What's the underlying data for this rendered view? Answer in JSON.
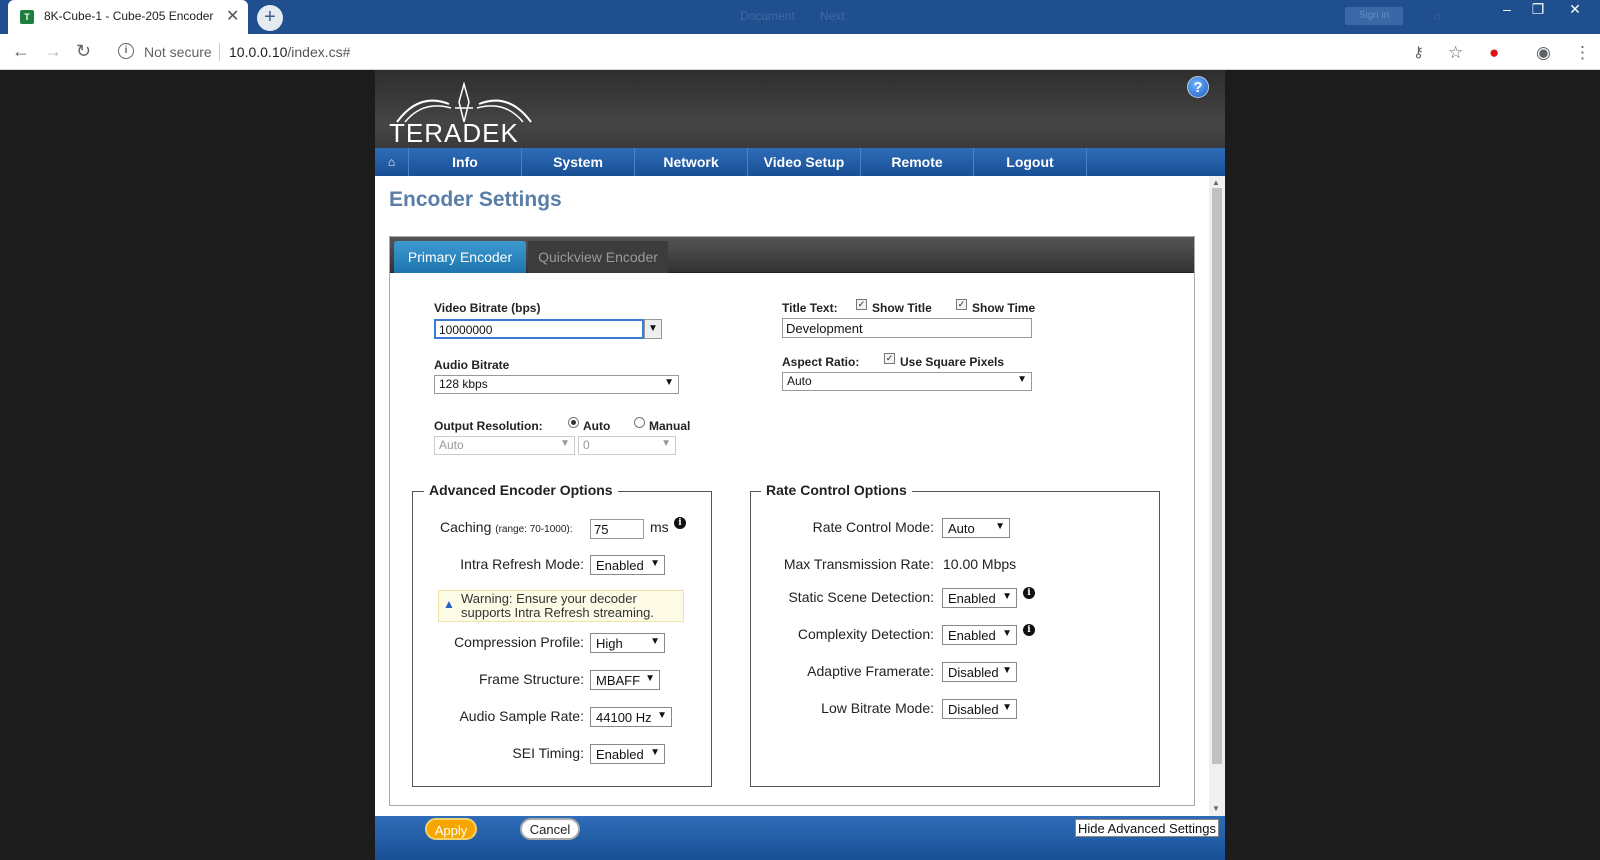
{
  "browser": {
    "tab_title": "8K-Cube-1 - Cube-205 Encoder",
    "faded_title_1": "Document",
    "faded_title_2": "Next",
    "faded_button": "Sign in",
    "not_secure": "Not secure",
    "url_host": "10.0.0.10",
    "url_path": "/index.cs#"
  },
  "brand": {
    "logo_text": "TERADEK"
  },
  "nav": [
    "Info",
    "System",
    "Network",
    "Video Setup",
    "Remote",
    "Logout"
  ],
  "page_title": "Encoder Settings",
  "tabs": {
    "primary": "Primary Encoder",
    "quickview": "Quickview Encoder"
  },
  "video_bitrate": {
    "label": "Video Bitrate (bps)",
    "value": "10000000"
  },
  "audio_bitrate": {
    "label": "Audio Bitrate",
    "value": "128 kbps"
  },
  "output_resolution": {
    "label": "Output Resolution:",
    "auto_label": "Auto",
    "manual_label": "Manual",
    "selected_mode": "Auto",
    "select1": "Auto",
    "select2": "0"
  },
  "title_text": {
    "label": "Title Text:",
    "show_title_label": "Show Title",
    "show_title_checked": true,
    "show_time_label": "Show Time",
    "show_time_checked": true,
    "value": "Development"
  },
  "aspect_ratio": {
    "label": "Aspect Ratio:",
    "square_label": "Use Square Pixels",
    "square_checked": true,
    "value": "Auto"
  },
  "advanced": {
    "legend": "Advanced Encoder Options",
    "caching_label": "Caching",
    "caching_range": "(range: 70-1000):",
    "caching_value": "75",
    "caching_unit": "ms",
    "intra_label": "Intra Refresh Mode:",
    "intra_value": "Enabled",
    "warning_line1": "Warning: Ensure your decoder",
    "warning_line2": "supports Intra Refresh streaming.",
    "profile_label": "Compression Profile:",
    "profile_value": "High",
    "frame_label": "Frame Structure:",
    "frame_value": "MBAFF",
    "sample_label": "Audio Sample Rate:",
    "sample_value": "44100 Hz",
    "sei_label": "SEI Timing:",
    "sei_value": "Enabled"
  },
  "rate": {
    "legend": "Rate Control Options",
    "mode_label": "Rate Control Mode:",
    "mode_value": "Auto",
    "max_label": "Max Transmission Rate:",
    "max_value": "10.00 Mbps",
    "static_label": "Static Scene Detection:",
    "static_value": "Enabled",
    "complexity_label": "Complexity Detection:",
    "complexity_value": "Enabled",
    "adaptive_label": "Adaptive Framerate:",
    "adaptive_value": "Disabled",
    "lowbitrate_label": "Low Bitrate Mode:",
    "lowbitrate_value": "Disabled"
  },
  "footer": {
    "apply": "Apply",
    "cancel": "Cancel",
    "hide_advanced": "Hide Advanced Settings"
  }
}
